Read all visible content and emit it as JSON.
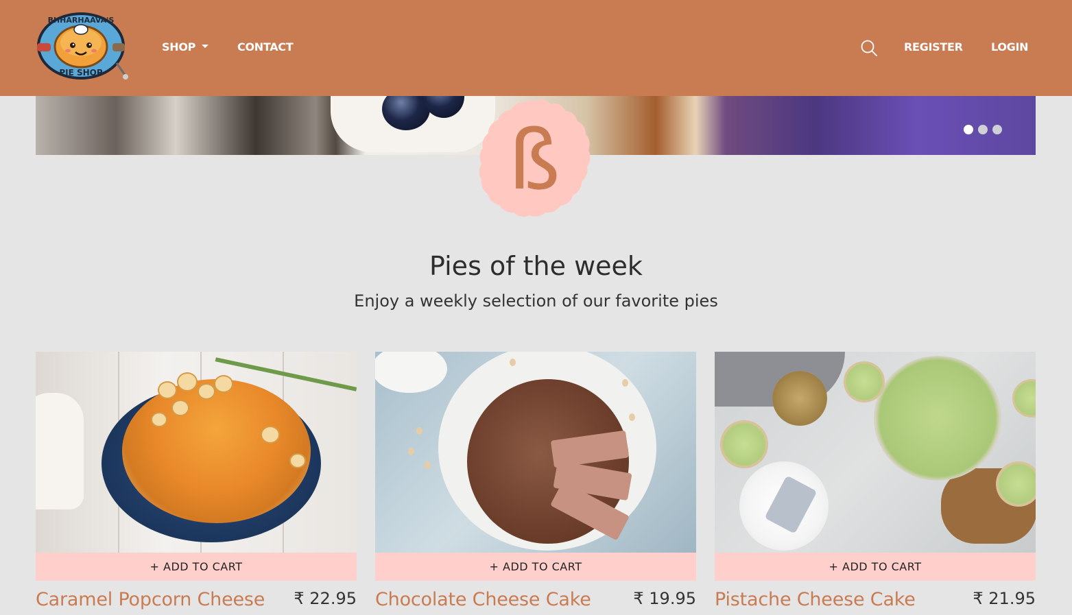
{
  "brand": {
    "logo_top_text": "BHHARHAAVA'S",
    "logo_bottom_text": "PIE SHOP",
    "accent_color": "#c97b52"
  },
  "nav": {
    "shop_label": "SHOP",
    "contact_label": "CONTACT",
    "search_icon": "search-icon",
    "register_label": "REGISTER",
    "login_label": "LOGIN"
  },
  "carousel": {
    "slide_count": 3,
    "active_index": 0
  },
  "badge": {
    "glyph": "ß"
  },
  "section": {
    "title": "Pies of the week",
    "subtitle": "Enjoy a weekly selection of our favorite pies"
  },
  "products": [
    {
      "name": "Caramel Popcorn Cheese",
      "price": "₹ 22.95",
      "cart_label": "+ ADD TO CART"
    },
    {
      "name": "Chocolate Cheese Cake",
      "price": "₹ 19.95",
      "cart_label": "+ ADD TO CART"
    },
    {
      "name": "Pistache Cheese Cake",
      "price": "₹ 21.95",
      "cart_label": "+ ADD TO CART"
    }
  ],
  "colors": {
    "page_bg": "#e5e5e5",
    "cart_button_bg": "#ffd0cb",
    "badge_bg": "#ffc9c2"
  }
}
